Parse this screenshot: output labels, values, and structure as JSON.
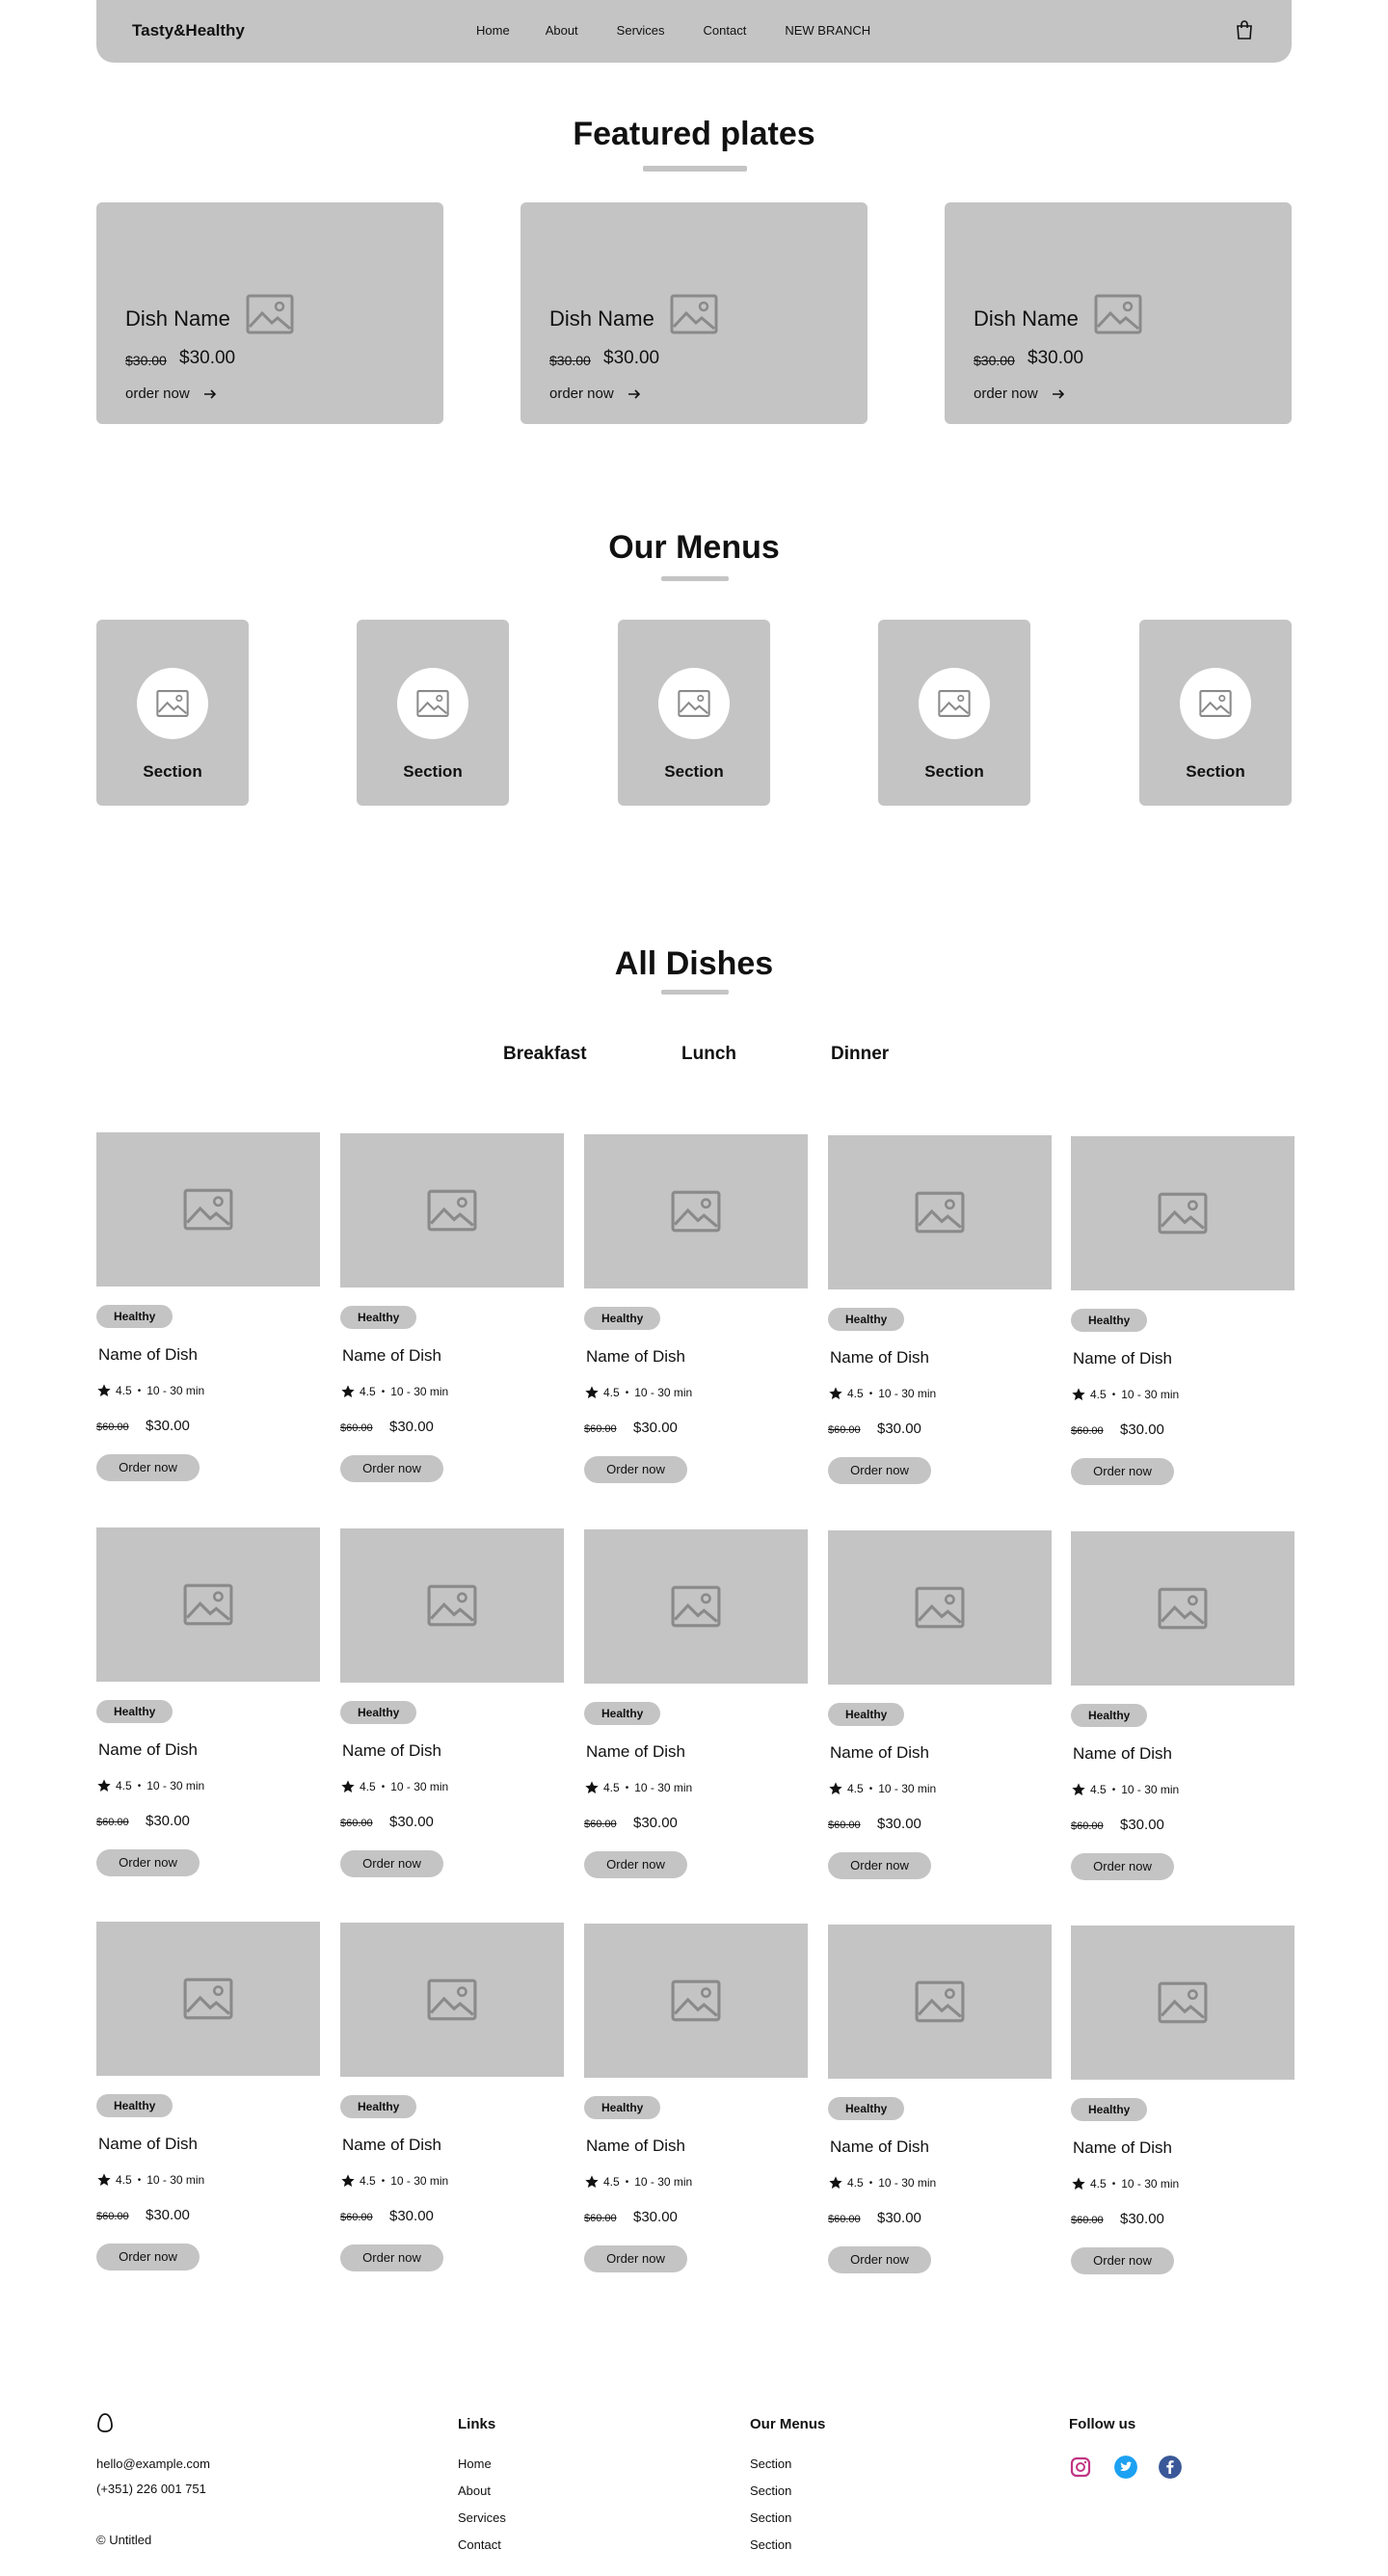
{
  "nav": {
    "brand": "Tasty&Healthy",
    "links": [
      "Home",
      "About",
      "Services",
      "Contact",
      "NEW BRANCH"
    ],
    "cart_icon": "shopping-bag-icon"
  },
  "featured": {
    "title": "Featured plates",
    "cards": [
      {
        "name": "Dish Name",
        "old_price": "$30.00",
        "price": "$30.00",
        "cta": "order now"
      },
      {
        "name": "Dish Name",
        "old_price": "$30.00",
        "price": "$30.00",
        "cta": "order now"
      },
      {
        "name": "Dish Name",
        "old_price": "$30.00",
        "price": "$30.00",
        "cta": "order now"
      }
    ]
  },
  "menus": {
    "title": "Our Menus",
    "items": [
      "Section",
      "Section",
      "Section",
      "Section",
      "Section"
    ]
  },
  "dishes": {
    "title": "All Dishes",
    "tabs": [
      "Breakfast",
      "Lunch",
      "Dinner"
    ],
    "card": {
      "badge": "Healthy",
      "name": "Name of Dish",
      "rating": "4.5",
      "time": "10 - 30 min",
      "old_price": "$60.00",
      "price": "$30.00",
      "cta": "Order now"
    },
    "rows": 3,
    "per_row": 5
  },
  "footer": {
    "logo_icon": "egg-logo-icon",
    "email": "hello@example.com",
    "phone": "(+351) 226 001 751",
    "copyright": "© Untitled",
    "links_title": "Links",
    "links": [
      "Home",
      "About",
      "Services",
      "Contact"
    ],
    "menus_title": "Our Menus",
    "menus": [
      "Section",
      "Section",
      "Section",
      "Section"
    ],
    "follow_title": "Follow us",
    "social_icons": [
      "instagram-icon",
      "twitter-icon",
      "facebook-icon"
    ]
  },
  "colors": {
    "placeholder_gray": "#c4c4c4",
    "instagram": "#c13584",
    "twitter": "#1da1f2",
    "facebook": "#3b5998"
  }
}
